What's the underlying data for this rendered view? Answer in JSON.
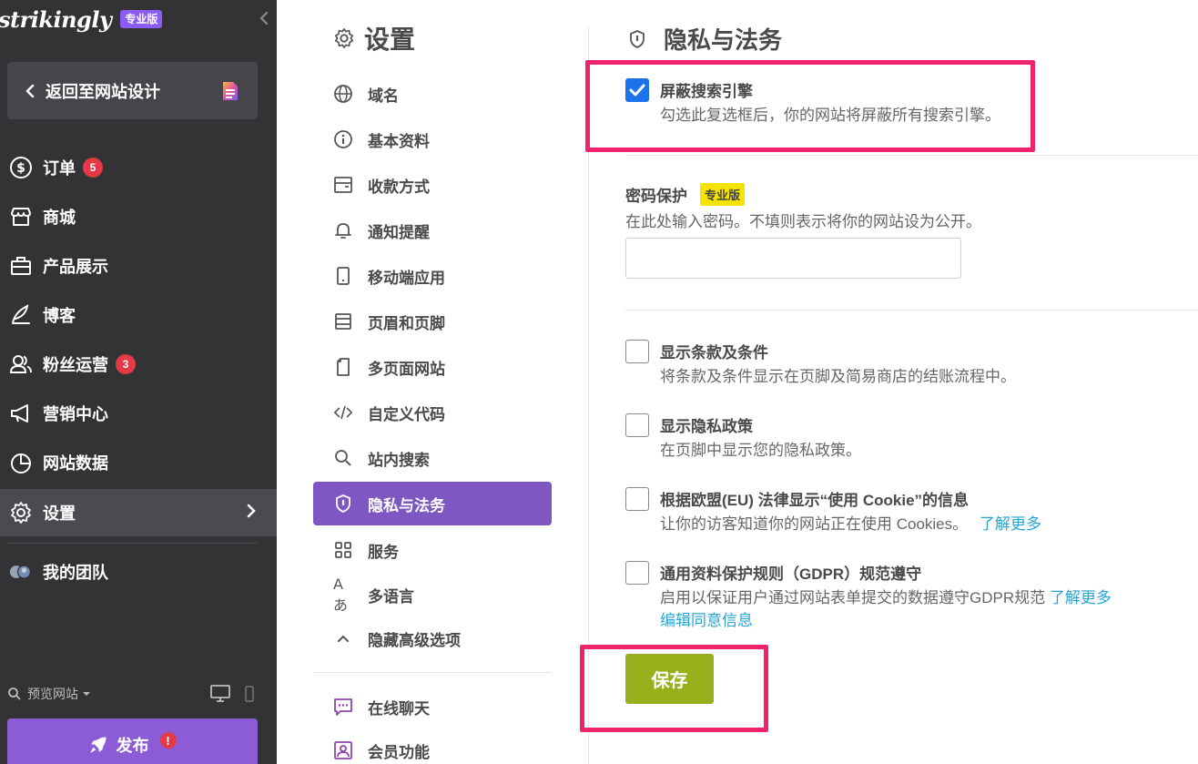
{
  "brand": {
    "name": "strikingly",
    "pro_badge": "专业版"
  },
  "back_button": {
    "label": "返回至网站设计"
  },
  "sidebar": {
    "items": [
      {
        "id": "orders",
        "label": "订单",
        "icon": "dollar-circle-icon",
        "badge": "5"
      },
      {
        "id": "store",
        "label": "商城",
        "icon": "store-icon"
      },
      {
        "id": "products",
        "label": "产品展示",
        "icon": "briefcase-icon"
      },
      {
        "id": "blog",
        "label": "博客",
        "icon": "quill-icon"
      },
      {
        "id": "fans",
        "label": "粉丝运营",
        "icon": "users-icon",
        "badge": "3"
      },
      {
        "id": "marketing",
        "label": "营销中心",
        "icon": "megaphone-icon"
      },
      {
        "id": "analytics",
        "label": "网站数据",
        "icon": "pie-chart-icon"
      },
      {
        "id": "settings",
        "label": "设置",
        "icon": "gear-icon",
        "active": true
      },
      {
        "id": "team",
        "label": "我的团队",
        "icon": "avatars-icon"
      }
    ],
    "preview_label": "预览网站",
    "publish_label": "发布",
    "publish_warning": "!"
  },
  "settings_menu": {
    "title": "设置",
    "items": [
      {
        "id": "domain",
        "label": "域名",
        "icon": "globe-icon"
      },
      {
        "id": "basic-info",
        "label": "基本资料",
        "icon": "info-icon"
      },
      {
        "id": "payment",
        "label": "收款方式",
        "icon": "wallet-icon"
      },
      {
        "id": "notifications",
        "label": "通知提醒",
        "icon": "bell-icon"
      },
      {
        "id": "mobile-app",
        "label": "移动端应用",
        "icon": "mobile-icon"
      },
      {
        "id": "header-footer",
        "label": "页眉和页脚",
        "icon": "layout-icon"
      },
      {
        "id": "multipage",
        "label": "多页面网站",
        "icon": "pages-icon"
      },
      {
        "id": "custom-code",
        "label": "自定义代码",
        "icon": "code-icon"
      },
      {
        "id": "site-search",
        "label": "站内搜索",
        "icon": "search-icon"
      },
      {
        "id": "privacy",
        "label": "隐私与法务",
        "icon": "shield-icon",
        "active": true
      },
      {
        "id": "services",
        "label": "服务",
        "icon": "grid-icon"
      },
      {
        "id": "multilang",
        "label": "多语言",
        "icon": "language-icon"
      },
      {
        "id": "advanced",
        "label": "隐藏高级选项",
        "icon": "chevron-up-icon"
      }
    ],
    "extra_items": [
      {
        "id": "live-chat",
        "label": "在线聊天",
        "icon": "chat-icon"
      },
      {
        "id": "membership",
        "label": "会员功能",
        "icon": "member-icon"
      }
    ]
  },
  "main": {
    "title": "隐私与法务",
    "block_search": {
      "title": "屏蔽搜索引擎",
      "desc": "勾选此复选框后，你的网站将屏蔽所有搜索引擎。",
      "checked": true
    },
    "password": {
      "title": "密码保护",
      "pro_badge": "专业版",
      "desc": "在此处输入密码。不填则表示将你的网站设为公开。",
      "value": "",
      "placeholder": ""
    },
    "terms": {
      "title": "显示条款及条件",
      "desc": "将条款及条件显示在页脚及简易商店的结账流程中。",
      "checked": false
    },
    "privacy_policy": {
      "title": "显示隐私政策",
      "desc": "在页脚中显示您的隐私政策。",
      "checked": false
    },
    "cookie": {
      "title": "根据欧盟(EU) 法律显示“使用 Cookie”的信息",
      "desc": "让你的访客知道你的网站正在使用 Cookies。",
      "link": "了解更多",
      "checked": false
    },
    "gdpr": {
      "title": "通用资料保护规则（GDPR）规范遵守",
      "desc": "启用以保证用户通过网站表单提交的数据遵守GDPR规范",
      "link": "了解更多",
      "link2": "编辑同意信息",
      "checked": false
    },
    "save_label": "保存"
  },
  "colors": {
    "sidebar_bg": "#333336",
    "accent_purple": "#7e57c2",
    "highlight": "#f0226b",
    "save_green": "#97b11c",
    "link_blue": "#26a6d6"
  }
}
